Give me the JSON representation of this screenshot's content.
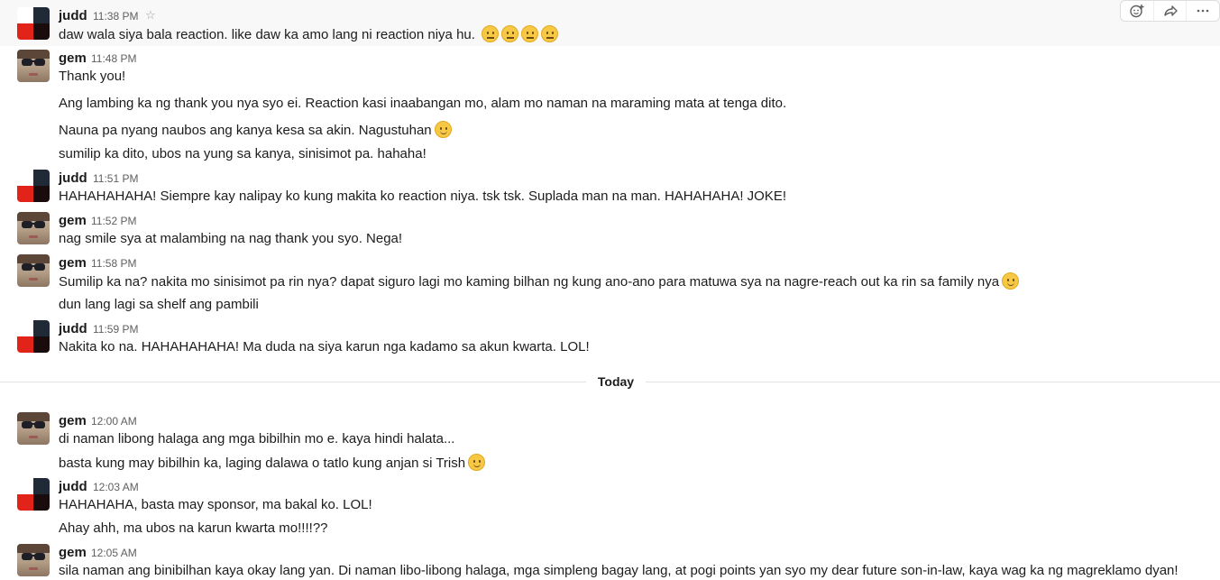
{
  "messages": [
    {
      "author": "judd",
      "time": "11:38 PM",
      "lines": [
        "daw wala siya bala reaction. like daw ka amo lang ni reaction niya hu."
      ]
    },
    {
      "author": "gem",
      "time": "11:48 PM",
      "lines": [
        "Thank you!",
        "Ang lambing ka ng thank you nya syo ei. Reaction kasi inaabangan mo, alam mo naman na maraming mata at tenga dito.",
        "Nauna pa nyang naubos ang kanya kesa sa akin. Nagustuhan",
        "sumilip ka dito, ubos na yung sa kanya, sinisimot pa. hahaha!"
      ]
    },
    {
      "author": "judd",
      "time": "11:51 PM",
      "lines": [
        "HAHAHAHAHA! Siempre kay nalipay ko kung makita ko reaction niya. tsk tsk. Suplada man na man. HAHAHAHA! JOKE!"
      ]
    },
    {
      "author": "gem",
      "time": "11:52 PM",
      "lines": [
        "nag smile sya at malambing na nag thank you syo. Nega!"
      ]
    },
    {
      "author": "gem",
      "time": "11:58 PM",
      "lines": [
        "Sumilip ka na? nakita mo sinisimot pa rin nya? dapat siguro lagi mo kaming bilhan ng kung ano-ano para matuwa sya na nagre-reach out ka rin sa family nya",
        "dun lang lagi sa shelf ang pambili"
      ]
    },
    {
      "author": "judd",
      "time": "11:59 PM",
      "lines": [
        "Nakita ko na. HAHAHAHAHA! Ma duda na siya karun nga kadamo sa akun kwarta. LOL!"
      ]
    },
    {
      "author": "gem",
      "time": "12:00 AM",
      "lines": [
        "di naman libong halaga ang mga bibilhin mo e. kaya hindi halata...",
        "basta kung may bibilhin ka, laging dalawa o tatlo kung anjan si Trish"
      ]
    },
    {
      "author": "judd",
      "time": "12:03 AM",
      "lines": [
        "HAHAHAHA, basta may sponsor, ma bakal ko. LOL!",
        "Ahay ahh, ma ubos na karun kwarta mo!!!!??"
      ]
    },
    {
      "author": "gem",
      "time": "12:05 AM",
      "lines": [
        "sila naman ang binibilhan kaya okay lang yan. Di naman libo-libong halaga, mga simpleng bagay lang, at pogi points yan syo my dear future son-in-law, kaya wag ka ng magreklamo dyan!"
      ]
    }
  ],
  "divider": {
    "label": "Today"
  },
  "icons": {
    "star": "star-icon",
    "add_reaction": "add-reaction-icon",
    "share": "share-icon",
    "more": "more-actions-icon",
    "neutral": "neutral-face-emoji",
    "smile": "slightly-smiling-face-emoji"
  }
}
